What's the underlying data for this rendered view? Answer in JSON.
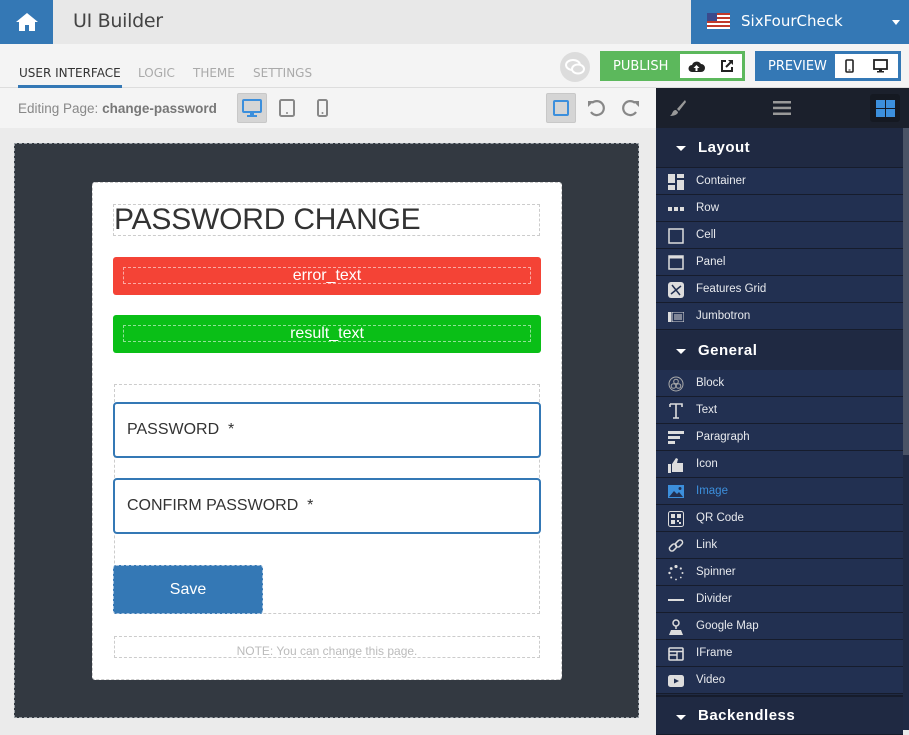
{
  "app": {
    "title": "UI Builder"
  },
  "project": {
    "name": "SixFourCheck",
    "flag": "us-flag-icon"
  },
  "tabs": [
    {
      "label": "USER INTERFACE",
      "active": true
    },
    {
      "label": "LOGIC",
      "active": false
    },
    {
      "label": "THEME",
      "active": false
    },
    {
      "label": "SETTINGS",
      "active": false
    }
  ],
  "toolbar": {
    "publish_label": "PUBLISH",
    "preview_label": "PREVIEW",
    "editing_prefix": "Editing Page:",
    "page_name": "change-password",
    "devices": [
      "desktop",
      "tablet",
      "mobile"
    ],
    "active_device": "desktop"
  },
  "page": {
    "title": "PASSWORD CHANGE",
    "error_text": "error_text",
    "result_text": "result_text",
    "fields": [
      {
        "label": "PASSWORD  *"
      },
      {
        "label": "CONFIRM PASSWORD  *"
      }
    ],
    "save_label": "Save",
    "note": "NOTE: You can change this page."
  },
  "colors": {
    "brand": "#3478b5",
    "publish": "#5cb85c",
    "error": "#f44336",
    "success": "#0abf17",
    "panel_bg": "#223051",
    "highlight": "#3c8fdc"
  },
  "panel": {
    "sections": [
      {
        "title": "Layout",
        "items": [
          {
            "label": "Container",
            "icon": "container-icon"
          },
          {
            "label": "Row",
            "icon": "row-icon"
          },
          {
            "label": "Cell",
            "icon": "cell-icon"
          },
          {
            "label": "Panel",
            "icon": "panel-icon"
          },
          {
            "label": "Features Grid",
            "icon": "features-grid-icon"
          },
          {
            "label": "Jumbotron",
            "icon": "jumbotron-icon"
          }
        ]
      },
      {
        "title": "General",
        "items": [
          {
            "label": "Block",
            "icon": "block-icon"
          },
          {
            "label": "Text",
            "icon": "text-icon"
          },
          {
            "label": "Paragraph",
            "icon": "paragraph-icon"
          },
          {
            "label": "Icon",
            "icon": "thumbs-up-icon"
          },
          {
            "label": "Image",
            "icon": "image-icon",
            "highlighted": true
          },
          {
            "label": "QR Code",
            "icon": "qr-code-icon"
          },
          {
            "label": "Link",
            "icon": "link-icon"
          },
          {
            "label": "Spinner",
            "icon": "spinner-icon"
          },
          {
            "label": "Divider",
            "icon": "divider-icon"
          },
          {
            "label": "Google Map",
            "icon": "map-marker-icon"
          },
          {
            "label": "IFrame",
            "icon": "iframe-icon"
          },
          {
            "label": "Video",
            "icon": "video-icon"
          }
        ]
      },
      {
        "title": "Backendless",
        "items": []
      }
    ]
  }
}
